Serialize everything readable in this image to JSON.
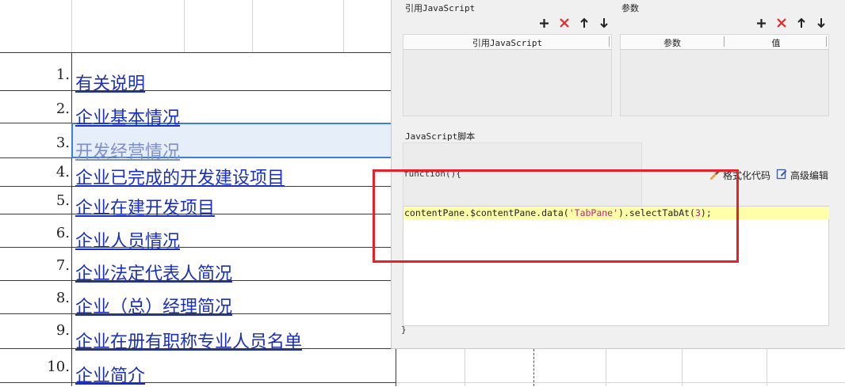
{
  "sheet": {
    "rows": [
      {
        "num": "1.",
        "label": "有关说明"
      },
      {
        "num": "2.",
        "label": "企业基本情况"
      },
      {
        "num": "3.",
        "label": "开发经营情况"
      },
      {
        "num": "4.",
        "label": "企业已完成的开发建设项目"
      },
      {
        "num": "5.",
        "label": "企业在建开发项目"
      },
      {
        "num": "6.",
        "label": "企业人员情况"
      },
      {
        "num": "7.",
        "label": "企业法定代表人简况"
      },
      {
        "num": "8.",
        "label": "企业（总）经理简况"
      },
      {
        "num": "9.",
        "label": "企业在册有职称专业人员名单"
      },
      {
        "num": "10.",
        "label": "企业简介"
      }
    ],
    "selected_row": 3
  },
  "dialog": {
    "ref_js_section": "引用JavaScript",
    "params_section": "参数",
    "ref_js_header": "引用JavaScript",
    "params_header_name": "参数",
    "params_header_value": "值",
    "script_section": "JavaScript脚本",
    "func_head": "function(){",
    "func_close": "}",
    "code": {
      "prefix": "contentPane.$contentPane.data(",
      "string": "'TabPane'",
      "middle": ").selectTabAt(",
      "number": "3",
      "suffix": ");"
    },
    "format_code": "格式化代码",
    "advanced_edit": "高级编辑",
    "toolbar_icons": [
      "plus-icon",
      "delete-x-icon",
      "arrow-up-icon",
      "arrow-down-icon"
    ]
  },
  "colors": {
    "accent_link": "#1a2fbf",
    "annotation_red": "#e8202a",
    "code_highlight": "#ffffaa",
    "string_literal": "#c21f7a"
  }
}
